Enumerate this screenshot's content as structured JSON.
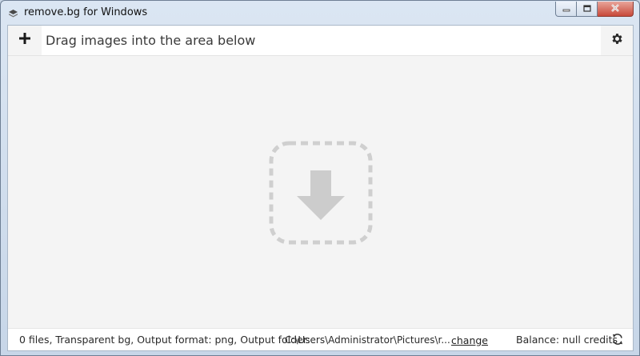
{
  "window": {
    "title": "remove.bg for Windows",
    "icons": {
      "app": "remove-bg-logo-icon",
      "minimize": "minimize-icon",
      "maximize": "maximize-icon",
      "close": "close-icon"
    }
  },
  "toolbar": {
    "add_icon": "plus-icon",
    "drag_prompt": "Drag images into the area below",
    "settings_icon": "gear-icon"
  },
  "dropzone": {
    "icon": "download-arrow-icon"
  },
  "status": {
    "info": "0 files, Transparent bg, Output format: png, Output folder:",
    "folder_path": "C:\\Users\\Administrator\\Pictures\\r...",
    "change_label": "change",
    "balance": "Balance: null credits",
    "refresh_icon": "refresh-icon"
  },
  "colors": {
    "close_button": "#c8493a",
    "dropzone_icon": "#cccccc",
    "content_background": "#f4f4f4"
  }
}
